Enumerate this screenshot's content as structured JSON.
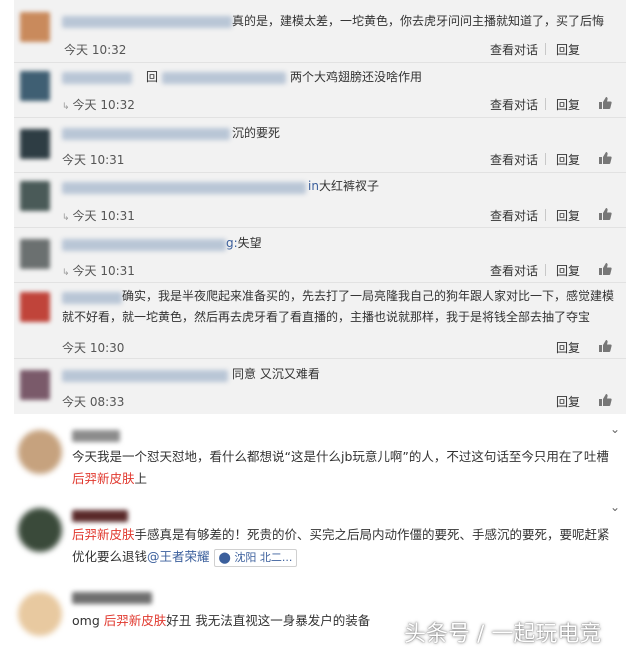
{
  "replies": [
    {
      "text_after": "真的是，建模太差，一坨黄色，你去虎牙问问主播就知道了，买了后悔",
      "time": "今天 10:32",
      "view_label": "查看对话",
      "reply_label": "回复",
      "avatar_color": "#c98a5c",
      "has_view": true
    },
    {
      "reply_word": "回",
      "text_after": "两个大鸡翅膀还没啥作用",
      "time": "今天 10:32",
      "view_label": "查看对话",
      "reply_label": "回复",
      "avatar_color": "#3f5f73",
      "has_view": true
    },
    {
      "text_after": "沉的要死",
      "time": "今天 10:31",
      "view_label": "查看对话",
      "reply_label": "回复",
      "avatar_color": "#2e3d44",
      "has_view": true
    },
    {
      "text_after": "大红裤衩子",
      "link_prefix": "in",
      "time": "今天 10:31",
      "view_label": "查看对话",
      "reply_label": "回复",
      "avatar_color": "#4a5a58",
      "has_view": true
    },
    {
      "text_after": "失望",
      "link_prefix": "g:",
      "time": "今天 10:31",
      "view_label": "查看对话",
      "reply_label": "回复",
      "avatar_color": "#6b7070",
      "has_view": true
    },
    {
      "line1": "确实，我是半夜爬起来准备买的，先去打了一局亮隆我自己的狗年跟人家对比一下，感觉建模",
      "line2": "就不好看，就一坨黄色，然后再去虎牙看了看直播的，主播也说就那样，我于是将钱全部去抽了夺宝",
      "time": "今天 10:30",
      "reply_label": "回复",
      "avatar_color": "#c0443a",
      "has_view": false
    },
    {
      "text_after": "同意 又沉又难看",
      "time": "今天 08:33",
      "reply_label": "回复",
      "avatar_color": "#7a5a6a",
      "has_view": false
    }
  ],
  "comments": [
    {
      "avatar_color": "#c6a27e",
      "line1": "今天我是一个怼天怼地，看什么都想说“这是什么jb玩意儿啊”的人，不过这句话至今只用在了吐槽",
      "hl": "后羿新皮肤",
      "line2_after": "上"
    },
    {
      "avatar_color": "#3a4a3a",
      "hl": "后羿新皮肤",
      "line1_after": "手感真是有够差的！死贵的价、买完之后局内动作僵的要死、手感沉的要死，要呢赶紧",
      "line2_before": "优化要么退钱",
      "at": "@王者荣耀",
      "location": "沈阳 北二..."
    },
    {
      "avatar_color": "#e8c9a0",
      "prefix": "omg ",
      "hl": "后羿新皮肤",
      "after": "好丑 我无法直视这一身暴发户的装备"
    }
  ],
  "watermark": "头条号 / 一起玩电竞",
  "icons": {
    "like": "thumbs-up-icon",
    "expand": "chevron-down-icon",
    "location": "location-pin-icon",
    "reply_arrow": "reply-arrow-icon"
  }
}
